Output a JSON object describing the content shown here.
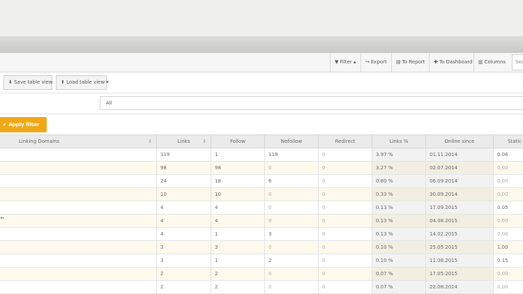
{
  "toolbar": {
    "filter": "Filter",
    "export": "Export",
    "to_report": "To Report",
    "to_dashboard": "To Dashboard",
    "columns": "Columns",
    "search_text": "Sea"
  },
  "views": {
    "save": "Save table view",
    "load": "Load table view"
  },
  "filter": {
    "select_value": "All",
    "apply": "Apply filter"
  },
  "table": {
    "headers": [
      "Linking Domains",
      "Links",
      "Follow",
      "Nofollow",
      "Redirect",
      "Links %",
      "Online since",
      "Static"
    ],
    "rows": [
      [
        "119",
        "1",
        "118",
        "0",
        "3.97 %",
        "01.11.2014",
        "0.06"
      ],
      [
        "98",
        "98",
        "0",
        "0",
        "3.27 %",
        "02.07.2014",
        "0,00"
      ],
      [
        "24",
        "18",
        "6",
        "0",
        "0.80 %",
        "06.09.2014",
        "0,00"
      ],
      [
        "10",
        "10",
        "0",
        "0",
        "0.33 %",
        "30.09.2014",
        "0,00"
      ],
      [
        "4",
        "4",
        "0",
        "0",
        "0.13 %",
        "17.09.2015",
        "0.05"
      ],
      [
        "4",
        "4",
        "0",
        "0",
        "0.13 %",
        "04.08.2015",
        "0,00"
      ],
      [
        "4",
        "1",
        "3",
        "0",
        "0.13 %",
        "14.02.2015",
        "0,00"
      ],
      [
        "3",
        "3",
        "0",
        "0",
        "0.10 %",
        "25.05.2015",
        "1.00"
      ],
      [
        "3",
        "1",
        "2",
        "0",
        "0.10 %",
        "11.08.2015",
        "0.15"
      ],
      [
        "2",
        "2",
        "0",
        "0",
        "0.07 %",
        "17.05.2015",
        "0,00"
      ],
      [
        "2",
        "2",
        "0",
        "0",
        "0.07 %",
        "22.08.2014",
        "0,00"
      ]
    ]
  },
  "icons": [
    "filter-icon",
    "share-icon",
    "file-icon",
    "plus-icon",
    "columns-icon",
    "download-icon",
    "upload-icon",
    "check-icon",
    "sort-icon"
  ]
}
